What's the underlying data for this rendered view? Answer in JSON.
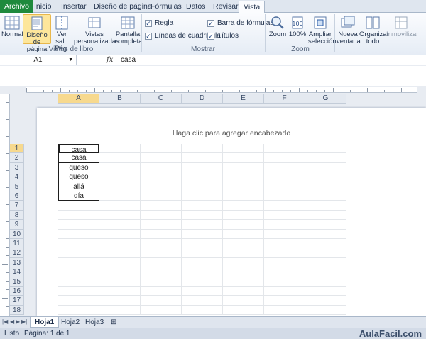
{
  "ribbon": {
    "tabs": [
      "Archivo",
      "Inicio",
      "Insertar",
      "Diseño de página",
      "Fórmulas",
      "Datos",
      "Revisar",
      "Vista"
    ],
    "active_tab": "Vista",
    "groups": {
      "vistas_libro": {
        "label": "Vistas de libro",
        "normal": "Normal",
        "diseno_pagina": [
          "Diseño",
          "de página"
        ],
        "ver_salt": [
          "Ver salt.",
          "Pág."
        ],
        "vistas_personalizadas": [
          "Vistas",
          "personalizadas"
        ],
        "pantalla_completa": [
          "Pantalla",
          "completa"
        ]
      },
      "mostrar": {
        "label": "Mostrar",
        "regla": "Regla",
        "lineas": "Líneas de cuadrícula",
        "barra_formulas": "Barra de fórmulas",
        "titulos": "Títulos"
      },
      "zoom": {
        "label": "Zoom",
        "zoom": "Zoom",
        "cien": "100%",
        "ampliar": [
          "Ampliar",
          "selección"
        ]
      },
      "ventana": {
        "nueva": [
          "Nueva",
          "ventana"
        ],
        "organizar": [
          "Organizar",
          "todo"
        ],
        "inmovilizar": "Inmovilizar"
      }
    }
  },
  "formula_bar": {
    "name_box": "A1",
    "fx": "fx",
    "value": "casa"
  },
  "columns": [
    "A",
    "B",
    "C",
    "D",
    "E",
    "F",
    "G"
  ],
  "rows": [
    "1",
    "2",
    "3",
    "4",
    "5",
    "6",
    "7",
    "8",
    "9",
    "10",
    "11",
    "12",
    "13",
    "14",
    "15",
    "16",
    "17",
    "18"
  ],
  "cells_a": [
    "casa",
    "casa",
    "queso",
    "queso",
    "allá",
    "día"
  ],
  "page_header": "Haga clic para agregar encabezado",
  "sheet_tabs": [
    "Hoja1",
    "Hoja2",
    "Hoja3"
  ],
  "status": {
    "ready": "Listo",
    "page": "Página: 1 de 1"
  },
  "watermark": "AulaFacil.com"
}
